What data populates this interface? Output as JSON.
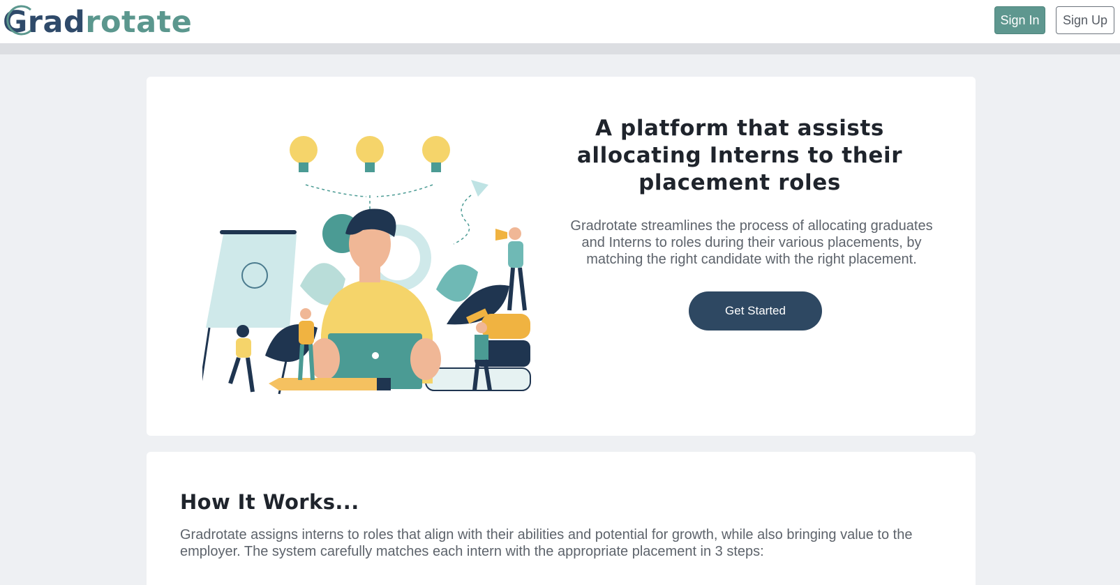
{
  "header": {
    "logo": {
      "prefix": "G",
      "dark_part": "rad",
      "accent_part": "rotate"
    },
    "sign_in_label": "Sign In",
    "sign_up_label": "Sign Up"
  },
  "hero": {
    "title": "A platform that assists allocating Interns to their placement roles",
    "description": "Gradrotate streamlines the process of allocating graduates and Interns to roles during their various placements, by matching the right candidate with the right placement.",
    "cta_label": "Get Started"
  },
  "how_it_works": {
    "title": "How It Works...",
    "description": "Gradrotate assigns interns to roles that align with their abilities and potential for growth, while also bringing value to the employer. The system carefully matches each intern with the appropriate placement in 3 steps:"
  },
  "colors": {
    "brand_dark": "#2f4a6a",
    "brand_teal": "#5b978e",
    "cta_navy": "#2e4862",
    "page_bg": "#eef0f3",
    "illustration_yellow": "#f5d46a",
    "illustration_teal": "#4b9b94"
  }
}
